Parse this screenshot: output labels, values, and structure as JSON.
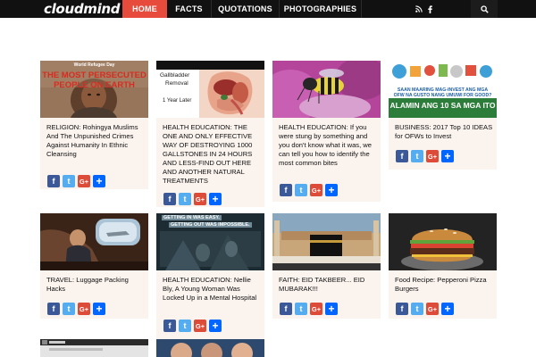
{
  "header": {
    "logo": "cloudmind",
    "nav": [
      {
        "label": "HOME",
        "active": true
      },
      {
        "label": "FACTS",
        "active": false
      },
      {
        "label": "QUOTATIONS",
        "active": false
      },
      {
        "label": "PHOTOGRAPHIES",
        "active": false
      }
    ],
    "icons": [
      "rss-icon",
      "facebook-icon",
      "search-icon"
    ]
  },
  "colors": {
    "topbar": "#111111",
    "active_nav": "#e64b3c",
    "card_bg": "#fbf3ee",
    "facebook": "#3b5998",
    "twitter": "#55acee",
    "google_plus": "#dd4b39",
    "share_more": "#0166ff"
  },
  "share_buttons": {
    "facebook": "f",
    "twitter": "t",
    "google_plus": "G+",
    "more": "+"
  },
  "thumb_texts": {
    "rohingya_line1": "World Refugee Day",
    "rohingya_line2": "THE MOST PERSECUTED",
    "rohingya_line3": "PEOPLE ON EARTH",
    "gallbladder_line1": "Gallbladder",
    "gallbladder_line2": "Removal",
    "gallbladder_line3": "1 Year Later",
    "ofw_line1": "SAAN MAARING MAG-INVEST ANG MGA",
    "ofw_line2": "OFW NA GUSTO NANG UMUWI FOR GOOD?",
    "ofw_line3": "ALAMIN ANG 10 SA MGA ITO",
    "nellie_line1": "GETTING IN WAS EASY.",
    "nellie_line2": "GETTING OUT WAS IMPOSSIBLE."
  },
  "posts": [
    {
      "title": "RELIGION: Rohingya Muslims And The Unpunished Crimes Against Humanity In Ethnic Cleansing"
    },
    {
      "title": "HEALTH EDUCATION: THE ONE AND ONLY EFFECTIVE WAY OF DESTROYING 1000 GALLSTONES IN 24 HOURS AND LESS-FIND OUT HERE AND ANOTHER NATURAL TREATMENTS"
    },
    {
      "title": "HEALTH EDUCATION: If you were stung by something and you don't know what it was, we can tell you how to identify the most common bites"
    },
    {
      "title": "BUSINESS: 2017 Top 10 IDEAS for OFWs to Invest"
    },
    {
      "title": "TRAVEL: Luggage Packing Hacks"
    },
    {
      "title": "HEALTH EDUCATION: Nellie Bly, A Young Woman Was Locked Up in a Mental Hospital"
    },
    {
      "title": "FAITH: EID TAKBEER... EID MUBARAK!!!"
    },
    {
      "title": "Food Recipe: Pepperoni Pizza Burgers"
    }
  ]
}
